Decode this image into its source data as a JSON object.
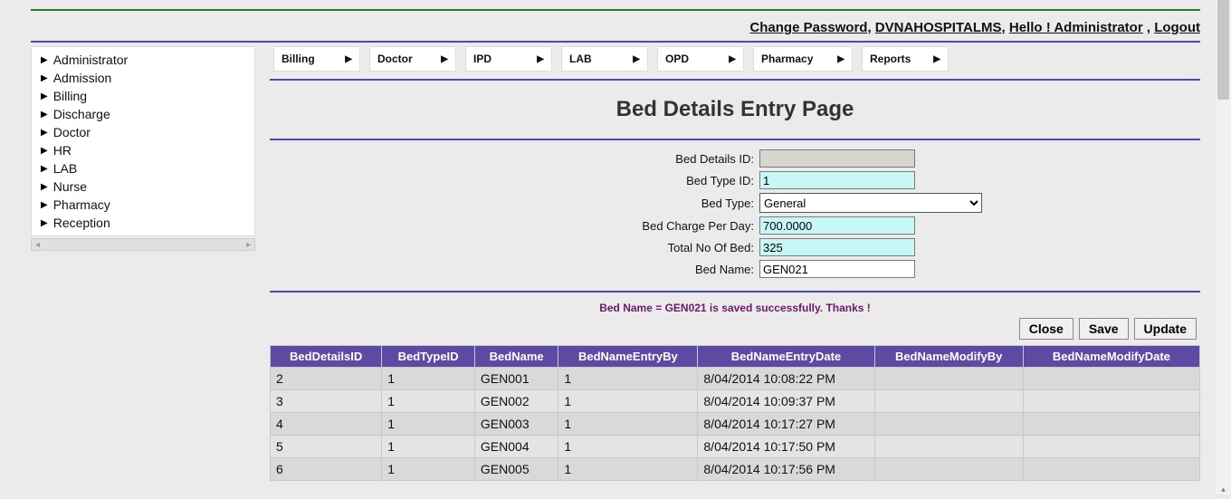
{
  "top_links": {
    "change_password": "Change Password",
    "app_name": "DVNAHOSPITALMS",
    "greeting": "Hello ! Administrator",
    "logout": "Logout"
  },
  "sidebar": {
    "items": [
      "Administrator",
      "Admission",
      "Billing",
      "Discharge",
      "Doctor",
      "HR",
      "LAB",
      "Nurse",
      "Pharmacy",
      "Reception"
    ]
  },
  "hmenu": {
    "items": [
      "Billing",
      "Doctor",
      "IPD",
      "LAB",
      "OPD",
      "Pharmacy",
      "Reports"
    ]
  },
  "page_title": "Bed Details Entry Page",
  "form": {
    "labels": {
      "bed_details_id": "Bed Details ID:",
      "bed_type_id": "Bed Type ID:",
      "bed_type": "Bed Type:",
      "bed_charge": "Bed Charge Per Day:",
      "total_no_bed": "Total No Of Bed:",
      "bed_name": "Bed Name:"
    },
    "values": {
      "bed_details_id": "",
      "bed_type_id": "1",
      "bed_type_selected": "General",
      "bed_type_options": [
        "General"
      ],
      "bed_charge": "700.0000",
      "total_no_bed": "325",
      "bed_name": "GEN021"
    }
  },
  "status_message": "Bed Name = GEN021 is saved successfully. Thanks !",
  "buttons": {
    "close": "Close",
    "save": "Save",
    "update": "Update"
  },
  "grid": {
    "headers": [
      "BedDetailsID",
      "BedTypeID",
      "BedName",
      "BedNameEntryBy",
      "BedNameEntryDate",
      "BedNameModifyBy",
      "BedNameModifyDate"
    ],
    "rows": [
      {
        "BedDetailsID": "2",
        "BedTypeID": "1",
        "BedName": "GEN001",
        "BedNameEntryBy": "1",
        "BedNameEntryDate": "8/04/2014 10:08:22 PM",
        "BedNameModifyBy": "",
        "BedNameModifyDate": ""
      },
      {
        "BedDetailsID": "3",
        "BedTypeID": "1",
        "BedName": "GEN002",
        "BedNameEntryBy": "1",
        "BedNameEntryDate": "8/04/2014 10:09:37 PM",
        "BedNameModifyBy": "",
        "BedNameModifyDate": ""
      },
      {
        "BedDetailsID": "4",
        "BedTypeID": "1",
        "BedName": "GEN003",
        "BedNameEntryBy": "1",
        "BedNameEntryDate": "8/04/2014 10:17:27 PM",
        "BedNameModifyBy": "",
        "BedNameModifyDate": ""
      },
      {
        "BedDetailsID": "5",
        "BedTypeID": "1",
        "BedName": "GEN004",
        "BedNameEntryBy": "1",
        "BedNameEntryDate": "8/04/2014 10:17:50 PM",
        "BedNameModifyBy": "",
        "BedNameModifyDate": ""
      },
      {
        "BedDetailsID": "6",
        "BedTypeID": "1",
        "BedName": "GEN005",
        "BedNameEntryBy": "1",
        "BedNameEntryDate": "8/04/2014 10:17:56 PM",
        "BedNameModifyBy": "",
        "BedNameModifyDate": ""
      }
    ]
  }
}
